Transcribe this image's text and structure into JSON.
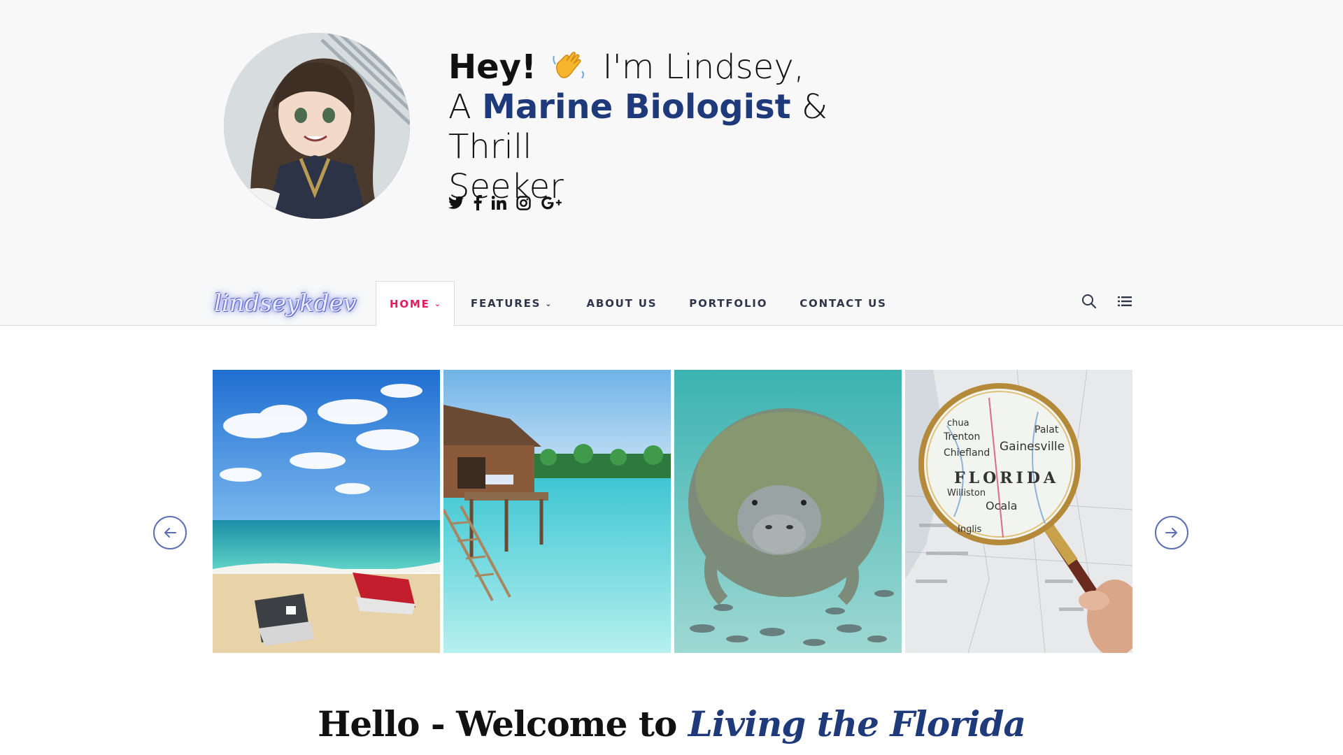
{
  "hero": {
    "greeting": "Hey!",
    "intro": "I'm Lindsey,",
    "line2_prefix": "A",
    "role": "Marine Biologist",
    "line2_suffix": "& Thrill",
    "line3": "Seeker",
    "socials": [
      "twitter-icon",
      "facebook-icon",
      "linkedin-icon",
      "instagram-icon",
      "google-plus-icon"
    ]
  },
  "nav": {
    "logo": "lindseykdev",
    "items": [
      {
        "label": "HOME",
        "dropdown": true,
        "active": true
      },
      {
        "label": "FEATURES",
        "dropdown": true,
        "active": false
      },
      {
        "label": "ABOUT US",
        "dropdown": false,
        "active": false
      },
      {
        "label": "PORTFOLIO",
        "dropdown": false,
        "active": false
      },
      {
        "label": "CONTACT US",
        "dropdown": false,
        "active": false
      }
    ],
    "chevron": "⌄"
  },
  "gallery": {
    "tiles": [
      "beach-jetskis-image",
      "overwater-bungalow-image",
      "manatee-image",
      "florida-map-magnifier-image"
    ]
  },
  "welcome": {
    "prefix": "Hello - Welcome to",
    "emphasis": "Living the Florida"
  },
  "colors": {
    "accent": "#1f3a7a",
    "active_nav": "#e21d5e",
    "hero_bg": "#f8f8f9"
  }
}
